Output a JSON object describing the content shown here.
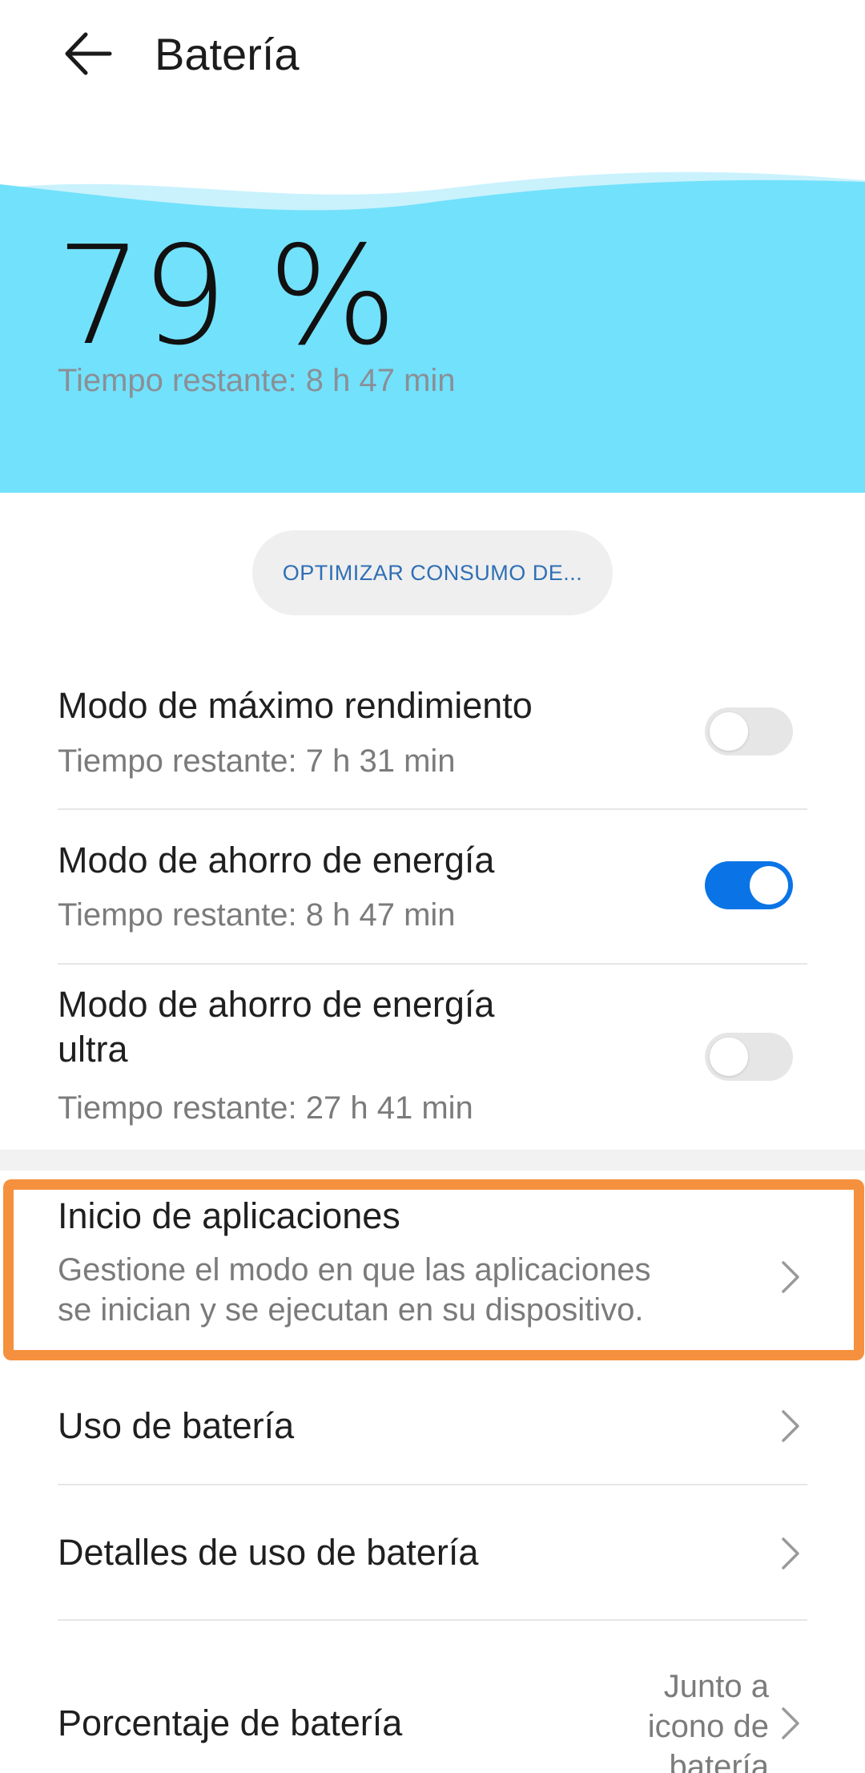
{
  "header": {
    "title": "Batería",
    "back_icon": "arrow-left-icon"
  },
  "battery": {
    "percent": "79 %",
    "level": 0.79,
    "remaining": "Tiempo restante: 8 h 47 min",
    "panel_color": "#72e1fc"
  },
  "optimize": {
    "label": "OPTIMIZAR CONSUMO DE..."
  },
  "modes": [
    {
      "title": "Modo de máximo rendimiento",
      "subtitle": "Tiempo restante: 7 h 31 min",
      "enabled": false
    },
    {
      "title": "Modo de ahorro de energía",
      "subtitle": "Tiempo restante: 8 h 47 min",
      "enabled": true
    },
    {
      "title_line1": "Modo de ahorro de energía",
      "title_line2": "ultra",
      "subtitle": "Tiempo restante: 27 h 41 min",
      "enabled": false
    }
  ],
  "settings": [
    {
      "title": "Inicio de aplicaciones",
      "desc_line1": "Gestione el modo en que las aplicaciones",
      "desc_line2": "se inician y se ejecutan en su dispositivo."
    },
    {
      "title": "Uso de batería"
    },
    {
      "title": "Detalles de uso de batería"
    },
    {
      "title": "Porcentaje de batería",
      "value_line1": "Junto a",
      "value_line2": "icono de",
      "value_line3": "batería"
    }
  ],
  "colors": {
    "accent": "#0a74e6",
    "highlight": "#f5913e"
  }
}
